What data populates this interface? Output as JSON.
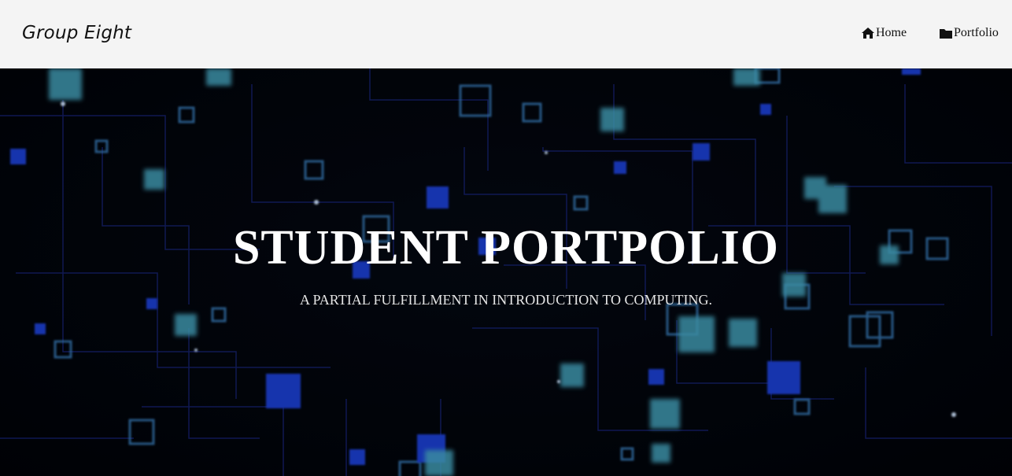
{
  "navbar": {
    "brand": "Group Eight",
    "links": [
      {
        "label": "Home",
        "icon": "home-icon"
      },
      {
        "label": "Portfolio",
        "icon": "folder-icon"
      }
    ]
  },
  "hero": {
    "title": "STUDENT PORTPOLIO",
    "subtitle": "A PARTIAL FULFILLMENT IN INTRODUCTION TO COMPUTING.",
    "background": "circuit-board-image"
  },
  "colors": {
    "navbar_bg": "#f4f4f4",
    "hero_bg": "#02050c",
    "circuit_blue": "#1f3fd0",
    "circuit_cyan": "#4fb3c8",
    "title_text": "#ffffff"
  }
}
